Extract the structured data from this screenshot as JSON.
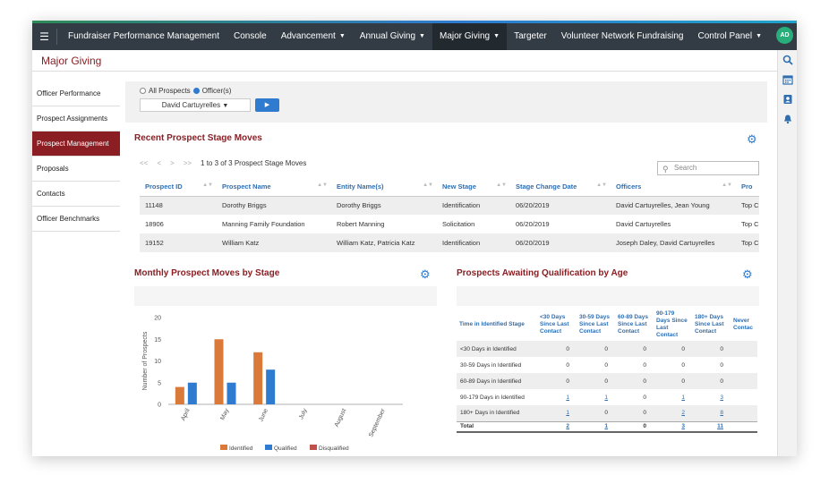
{
  "nav": {
    "accent_colors": [
      "#2e8b57",
      "#2f7bd0",
      "#1fa3c9"
    ],
    "menu_icon": "menu-icon",
    "items": [
      {
        "label": "Fundraiser Performance Management",
        "caret": false
      },
      {
        "label": "Console",
        "caret": false
      },
      {
        "label": "Advancement",
        "caret": true
      },
      {
        "label": "Annual Giving",
        "caret": true
      },
      {
        "label": "Major Giving",
        "caret": true,
        "active": true
      },
      {
        "label": "Targeter",
        "caret": false
      },
      {
        "label": "Volunteer Network Fundraising",
        "caret": false
      },
      {
        "label": "Control Panel",
        "caret": true
      }
    ],
    "avatar": "AD"
  },
  "page": {
    "title": "Major Giving"
  },
  "right_toolbar": [
    "search-icon",
    "calendar-icon",
    "contact-card-icon",
    "bell-icon"
  ],
  "sidebar": {
    "items": [
      {
        "label": "Officer Performance"
      },
      {
        "label": "Prospect Assignments"
      },
      {
        "label": "Prospect Management",
        "active": true
      },
      {
        "label": "Proposals"
      },
      {
        "label": "Contacts"
      },
      {
        "label": "Officer Benchmarks"
      }
    ]
  },
  "filters": {
    "radio_all": "All Prospects",
    "radio_officers": "Officer(s)",
    "selected_radio": "Officer(s)",
    "officer_select": "David Cartuyrelles"
  },
  "recent_moves": {
    "title": "Recent Prospect Stage Moves",
    "pager": {
      "first": "<<",
      "prev": "<",
      "next": ">",
      "last": ">>",
      "summary": "1 to 3 of 3 Prospect Stage Moves"
    },
    "search_placeholder": "Search",
    "columns": [
      "Prospect ID",
      "Prospect Name",
      "Entity Name(s)",
      "New Stage",
      "Stage Change Date",
      "Officers",
      "Pro"
    ],
    "rows": [
      {
        "id": "11148",
        "name": "Dorothy Briggs",
        "entities": "Dorothy Briggs",
        "stage": "Identification",
        "date": "06/20/2019",
        "officers": "David Cartuyrelles, Jean Young",
        "pro": "Top C"
      },
      {
        "id": "18906",
        "name": "Manning Family Foundation",
        "entities": "Robert Manning",
        "stage": "Solicitation",
        "date": "06/20/2019",
        "officers": "David Cartuyrelles",
        "pro": "Top C"
      },
      {
        "id": "19152",
        "name": "William Katz",
        "entities": "William Katz, Patricia Katz",
        "stage": "Identification",
        "date": "06/20/2019",
        "officers": "Joseph Daley, David Cartuyrelles",
        "pro": "Top C"
      }
    ]
  },
  "monthly": {
    "title": "Monthly Prospect Moves by Stage"
  },
  "chart_data": {
    "type": "bar",
    "categories": [
      "April",
      "May",
      "June",
      "July",
      "August",
      "September"
    ],
    "series": [
      {
        "name": "Identified",
        "color": "#d9793a",
        "values": [
          4,
          15,
          12,
          0,
          0,
          0
        ]
      },
      {
        "name": "Qualified",
        "color": "#2f7bd0",
        "values": [
          5,
          5,
          8,
          0,
          0,
          0
        ]
      },
      {
        "name": "Disqualified",
        "color": "#c0504d",
        "values": [
          0,
          0,
          0,
          0,
          0,
          0
        ]
      }
    ],
    "ylabel": "Number of Prospects",
    "ylim": [
      0,
      20
    ],
    "yticks": [
      0,
      5,
      10,
      15,
      20
    ],
    "legend": "bottom"
  },
  "awaiting": {
    "title": "Prospects Awaiting Qualification by Age",
    "columns": [
      "Time in Identified Stage",
      "<30 Days Since Last Contact",
      "30-59 Days Since Last Contact",
      "60-89 Days Since Last Contact",
      "90-179 Days Since Last Contact",
      "180+ Days Since Last Contact",
      "Never Contac"
    ],
    "rows": [
      {
        "label": "<30 Days in Identified",
        "values": [
          "0",
          "0",
          "0",
          "0",
          "0"
        ]
      },
      {
        "label": "30-59 Days in Identified",
        "values": [
          "0",
          "0",
          "0",
          "0",
          "0"
        ]
      },
      {
        "label": "60-89 Days in Identified",
        "values": [
          "0",
          "0",
          "0",
          "0",
          "0"
        ]
      },
      {
        "label": "90-179 Days in Identified",
        "values": [
          "1",
          "1",
          "0",
          "1",
          "3"
        ]
      },
      {
        "label": "180+ Days in Identified",
        "values": [
          "1",
          "0",
          "0",
          "2",
          "8"
        ]
      }
    ],
    "total": {
      "label": "Total",
      "values": [
        "2",
        "1",
        "0",
        "3",
        "11"
      ]
    }
  }
}
